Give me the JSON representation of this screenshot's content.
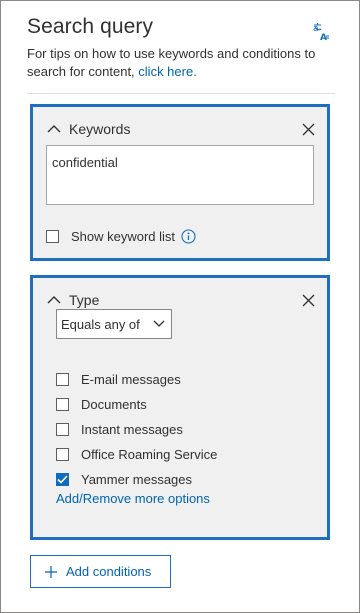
{
  "panel": {
    "title": "Search query",
    "tips_text": "For tips on how to use keywords and conditions to search for content,",
    "tips_link": "click here.",
    "icon": "language-translate-icon"
  },
  "keywords": {
    "header": "Keywords",
    "value": "confidential",
    "show_list_label": "Show keyword list",
    "show_list_checked": false
  },
  "type": {
    "header": "Type",
    "operator": "Equals any of",
    "options": [
      {
        "label": "E-mail messages",
        "checked": false
      },
      {
        "label": "Documents",
        "checked": false
      },
      {
        "label": "Instant messages",
        "checked": false
      },
      {
        "label": "Office Roaming Service",
        "checked": false
      },
      {
        "label": "Yammer messages",
        "checked": true
      }
    ],
    "more_link": "Add/Remove more options"
  },
  "add_conditions": {
    "label": "Add conditions"
  },
  "colors": {
    "accent": "#1f6ebf",
    "link": "#0064b4",
    "card_bg": "#f0f0f0"
  }
}
